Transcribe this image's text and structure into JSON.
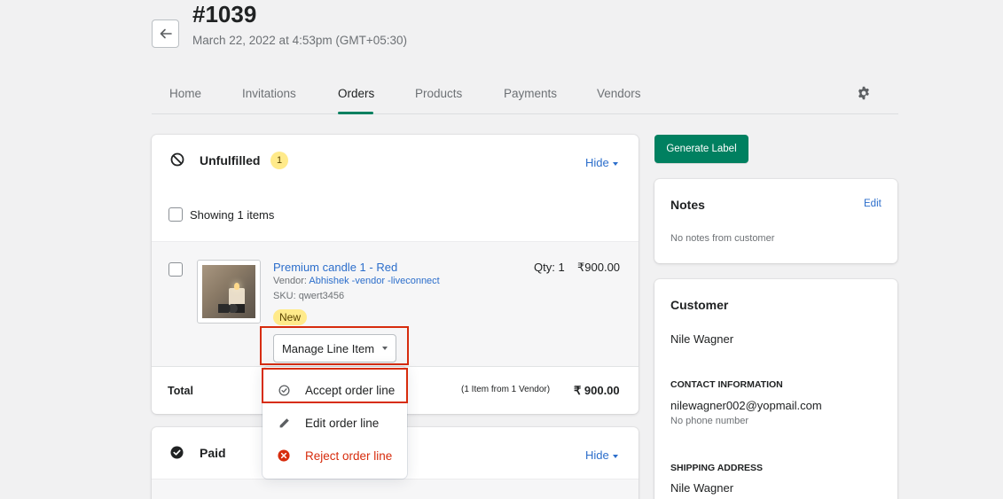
{
  "header": {
    "order_number": "#1039",
    "order_date": "March 22, 2022 at 4:53pm (GMT+05:30)"
  },
  "tabs": [
    {
      "label": "Home",
      "active": false
    },
    {
      "label": "Invitations",
      "active": false
    },
    {
      "label": "Orders",
      "active": true
    },
    {
      "label": "Products",
      "active": false
    },
    {
      "label": "Payments",
      "active": false
    },
    {
      "label": "Vendors",
      "active": false
    }
  ],
  "unfulfilled": {
    "title": "Unfulfilled",
    "count": "1",
    "hide_label": "Hide",
    "showing_label": "Showing 1 items",
    "item": {
      "name": "Premium candle 1 - Red",
      "vendor_prefix": "Vendor:",
      "vendor_name": "Abhishek -vendor -liveconnect",
      "sku": "SKU: qwert3456",
      "status_badge": "New",
      "qty": "Qty: 1",
      "price": "₹900.00"
    },
    "manage_button": "Manage Line Item",
    "total_label": "Total",
    "total_summary": "(1 Item from 1 Vendor)",
    "total_value": "₹ 900.00"
  },
  "line_item_menu": {
    "accept": "Accept order line",
    "edit": "Edit order line",
    "reject": "Reject order line"
  },
  "paid": {
    "title": "Paid",
    "hide_label": "Hide"
  },
  "sidebar": {
    "generate_label": "Generate Label",
    "notes_title": "Notes",
    "notes_edit": "Edit",
    "notes_empty": "No notes from customer",
    "customer_title": "Customer",
    "customer_name": "Nile Wagner",
    "contact_heading": "CONTACT INFORMATION",
    "contact_email": "nilewagner002@yopmail.com",
    "contact_phone": "No phone number",
    "shipping_heading": "SHIPPING ADDRESS",
    "shipping_name": "Nile Wagner"
  },
  "colors": {
    "primary": "#008060",
    "link": "#2c6ecb",
    "critical": "#d72c0d",
    "badge": "#ffea8a"
  }
}
